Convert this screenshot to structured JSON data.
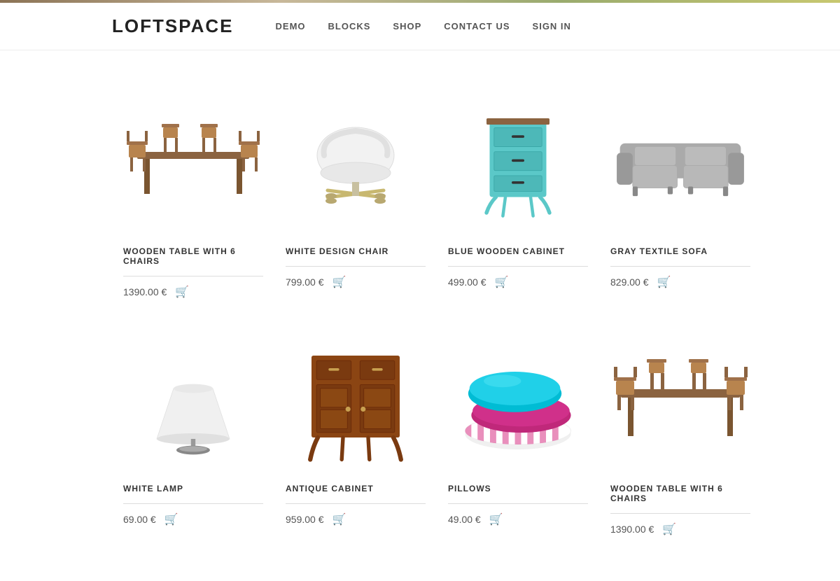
{
  "topbar": {},
  "header": {
    "logo": "LOFTSPACE",
    "nav": [
      {
        "label": "DEMO",
        "href": "#"
      },
      {
        "label": "BLOCKS",
        "href": "#"
      },
      {
        "label": "SHOP",
        "href": "#"
      },
      {
        "label": "CONTACT US",
        "href": "#"
      },
      {
        "label": "SIGN IN",
        "href": "#"
      }
    ]
  },
  "products": [
    {
      "id": "wooden-table-6-chairs",
      "title": "WOODEN TABLE WITH 6 CHAIRS",
      "price": "1390.00 €",
      "color": "#8B6340",
      "shape": "table-chairs"
    },
    {
      "id": "white-design-chair",
      "title": "WHITE DESIGN CHAIR",
      "price": "799.00 €",
      "color": "#f0f0f0",
      "shape": "chair"
    },
    {
      "id": "blue-wooden-cabinet",
      "title": "BLUE WOODEN CABINET",
      "price": "499.00 €",
      "color": "#5BC8C8",
      "shape": "cabinet"
    },
    {
      "id": "gray-textile-sofa",
      "title": "GRAY TEXTILE SOFA",
      "price": "829.00 €",
      "color": "#aaaaaa",
      "shape": "sofa"
    },
    {
      "id": "white-lamp",
      "title": "WHITE LAMP",
      "price": "69.00 €",
      "color": "#f5f5f5",
      "shape": "lamp"
    },
    {
      "id": "antique-cabinet",
      "title": "ANTIQUE CABINET",
      "price": "959.00 €",
      "color": "#8B4513",
      "shape": "antique-cabinet"
    },
    {
      "id": "pillows",
      "title": "PILLOWS",
      "price": "49.00 €",
      "color": "#00BCD4",
      "shape": "pillows"
    },
    {
      "id": "wooden-table-6-chairs-2",
      "title": "WOODEN TABLE WITH 6 CHAIRS",
      "price": "1390.00 €",
      "color": "#8B6340",
      "shape": "table-chairs-2"
    }
  ]
}
